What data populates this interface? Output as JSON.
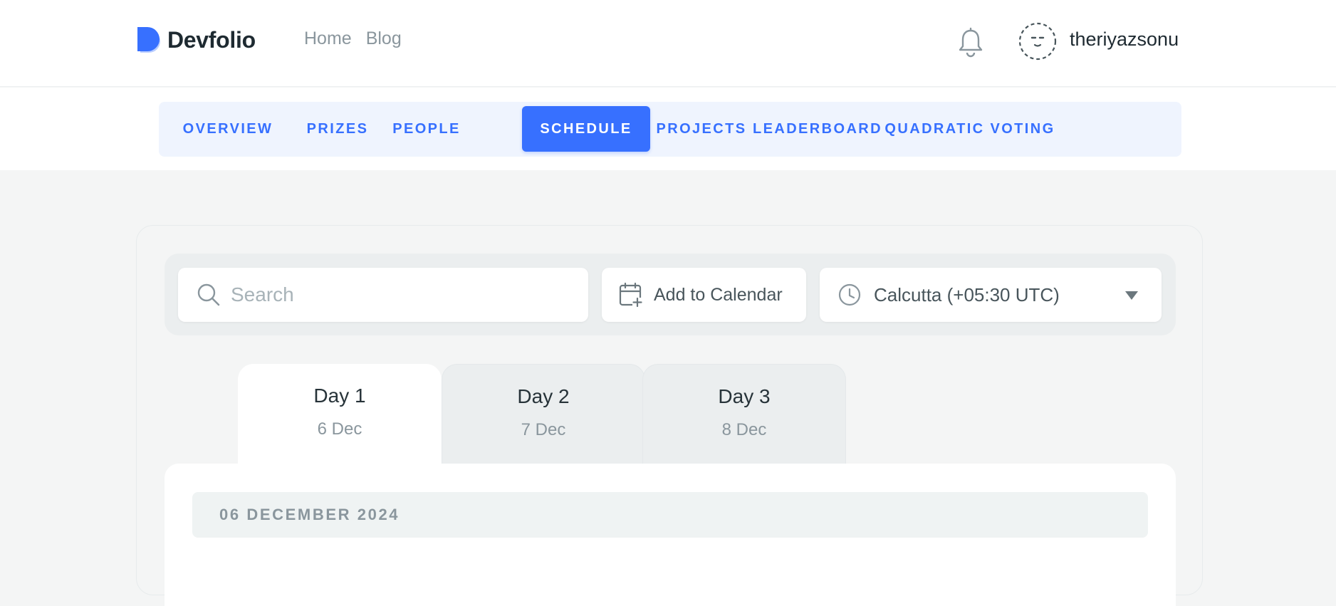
{
  "header": {
    "brand": "Devfolio",
    "brand_color": "#3770ff",
    "nav": [
      "Home",
      "Blog"
    ],
    "notification_icon": "bell-icon",
    "avatar_icon": "avatar-face-icon",
    "username": "theriyazsonu"
  },
  "tabs": {
    "items": [
      {
        "label": "OVERVIEW",
        "active": false
      },
      {
        "label": "PRIZES",
        "active": false
      },
      {
        "label": "PEOPLE",
        "active": false
      },
      {
        "label": "SCHEDULE",
        "active": true
      },
      {
        "label": "PROJECTS",
        "active": false
      },
      {
        "label": "LEADERBOARD",
        "active": false
      },
      {
        "label": "QUADRATIC VOTING",
        "active": false
      }
    ],
    "accent": "#3770ff"
  },
  "filters": {
    "search_placeholder": "Search",
    "search_icon": "search-icon",
    "add_to_calendar": "Add to Calendar",
    "calendar_icon": "calendar-add-icon",
    "timezone": "Calcutta (+05:30 UTC)",
    "timezone_icon": "clock-icon"
  },
  "days": [
    {
      "title": "Day 1",
      "date": "6 Dec",
      "active": true
    },
    {
      "title": "Day 2",
      "date": "7 Dec",
      "active": false
    },
    {
      "title": "Day 3",
      "date": "8 Dec",
      "active": false
    }
  ],
  "schedule": {
    "date_heading": "06 DECEMBER 2024"
  }
}
